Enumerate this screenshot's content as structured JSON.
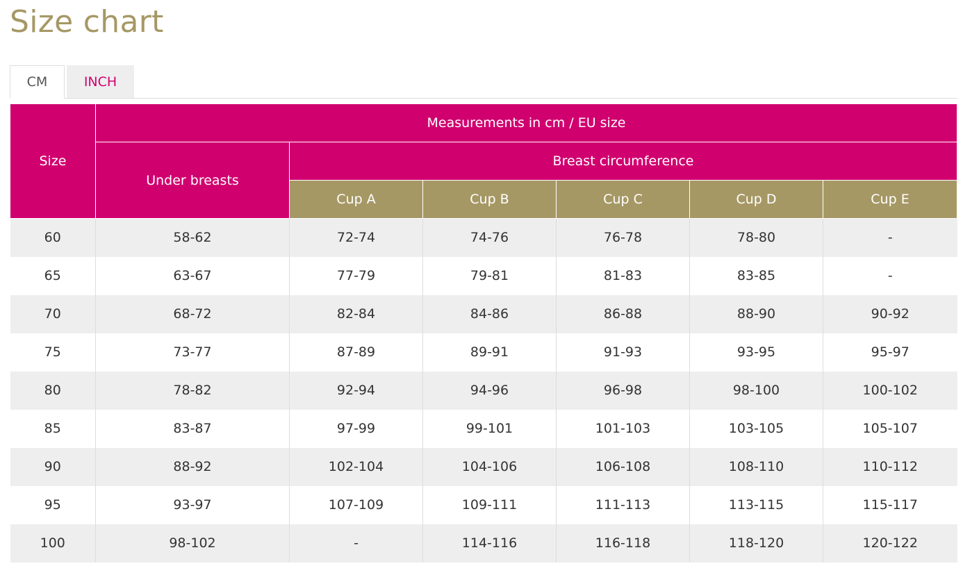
{
  "page": {
    "title": "Size chart"
  },
  "tabs": [
    {
      "label": "CM",
      "active": true
    },
    {
      "label": "INCH",
      "active": false
    }
  ],
  "table": {
    "header": {
      "size": "Size",
      "measurements": "Measurements in cm / EU size",
      "under_breasts": "Under breasts",
      "breast_circumference": "Breast circumference",
      "cups": [
        "Cup A",
        "Cup B",
        "Cup C",
        "Cup D",
        "Cup E"
      ]
    },
    "rows": [
      [
        "60",
        "58-62",
        "72-74",
        "74-76",
        "76-78",
        "78-80",
        "-"
      ],
      [
        "65",
        "63-67",
        "77-79",
        "79-81",
        "81-83",
        "83-85",
        "-"
      ],
      [
        "70",
        "68-72",
        "82-84",
        "84-86",
        "86-88",
        "88-90",
        "90-92"
      ],
      [
        "75",
        "73-77",
        "87-89",
        "89-91",
        "91-93",
        "93-95",
        "95-97"
      ],
      [
        "80",
        "78-82",
        "92-94",
        "94-96",
        "96-98",
        "98-100",
        "100-102"
      ],
      [
        "85",
        "83-87",
        "97-99",
        "99-101",
        "101-103",
        "103-105",
        "105-107"
      ],
      [
        "90",
        "88-92",
        "102-104",
        "104-106",
        "106-108",
        "108-110",
        "110-112"
      ],
      [
        "95",
        "93-97",
        "107-109",
        "109-111",
        "111-113",
        "113-115",
        "115-117"
      ],
      [
        "100",
        "98-102",
        "-",
        "114-116",
        "116-118",
        "118-120",
        "120-122"
      ]
    ]
  },
  "colors": {
    "title": "#a69865",
    "header_pink": "#d1006f",
    "header_gold": "#a69865",
    "tab_inactive_text": "#d1006f",
    "row_stripe": "#eeeeee"
  }
}
